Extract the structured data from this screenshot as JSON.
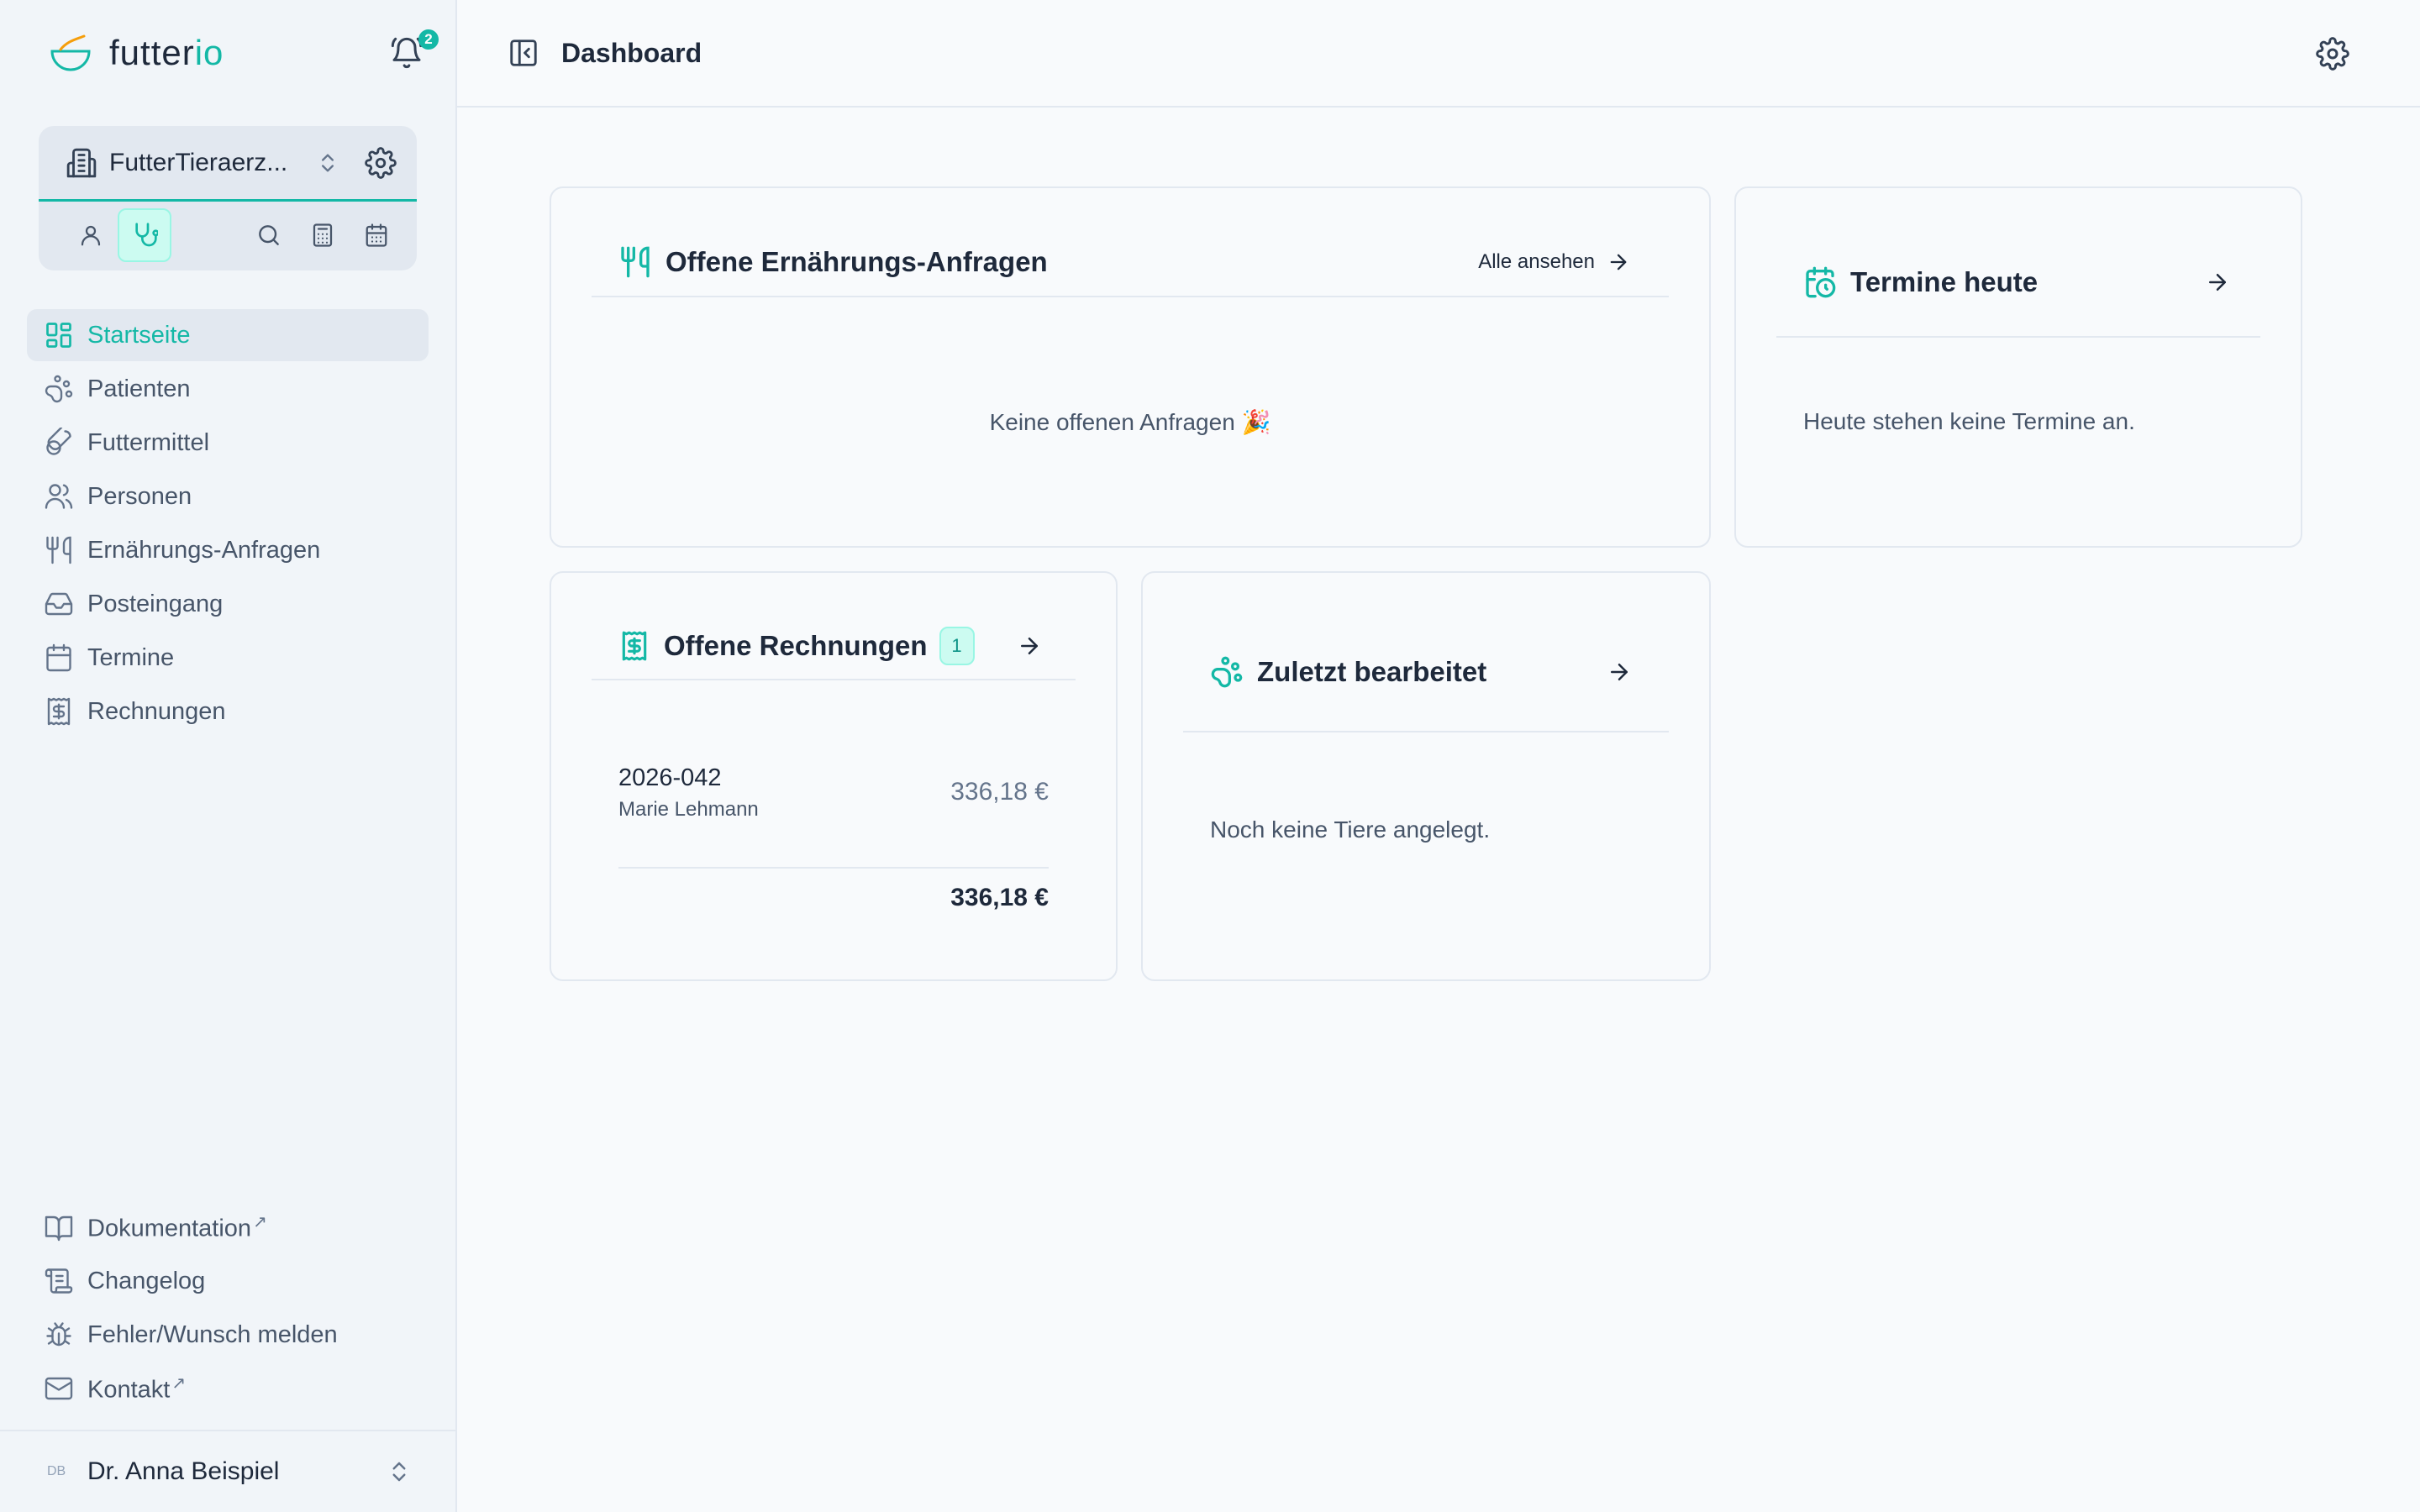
{
  "brand": {
    "name_part1": "futter",
    "name_part2": "io"
  },
  "notifications": {
    "count": "2"
  },
  "org": {
    "name": "FutterTieraerz..."
  },
  "nav": {
    "items": [
      {
        "label": "Startseite"
      },
      {
        "label": "Patienten"
      },
      {
        "label": "Futtermittel"
      },
      {
        "label": "Personen"
      },
      {
        "label": "Ernährungs-Anfragen"
      },
      {
        "label": "Posteingang"
      },
      {
        "label": "Termine"
      },
      {
        "label": "Rechnungen"
      }
    ],
    "active": "Startseite"
  },
  "bottom_nav": {
    "items": [
      {
        "label": "Dokumentation",
        "external": "↗"
      },
      {
        "label": "Changelog"
      },
      {
        "label": "Fehler/Wunsch melden"
      },
      {
        "label": "Kontakt",
        "external": "↗"
      }
    ]
  },
  "user": {
    "initials": "DB",
    "name": "Dr. Anna Beispiel"
  },
  "header": {
    "title": "Dashboard"
  },
  "cards": {
    "requests": {
      "title": "Offene Ernährungs-Anfragen",
      "link": "Alle ansehen",
      "empty": "Keine offenen Anfragen 🎉"
    },
    "appointments": {
      "title": "Termine heute",
      "empty": "Heute stehen keine Termine an."
    },
    "invoices": {
      "title": "Offene Rechnungen",
      "count": "1",
      "rows": [
        {
          "number": "2026-042",
          "customer": "Marie Lehmann",
          "amount": "336,18 €"
        }
      ],
      "total": "336,18 €"
    },
    "recent": {
      "title": "Zuletzt bearbeitet",
      "empty": "Noch keine Tiere angelegt."
    }
  },
  "colors": {
    "accent": "#14b8a6",
    "text": "#1e293b",
    "muted": "#475569",
    "border": "#e2e8f0",
    "sidebar_bg": "#f1f5f9"
  }
}
